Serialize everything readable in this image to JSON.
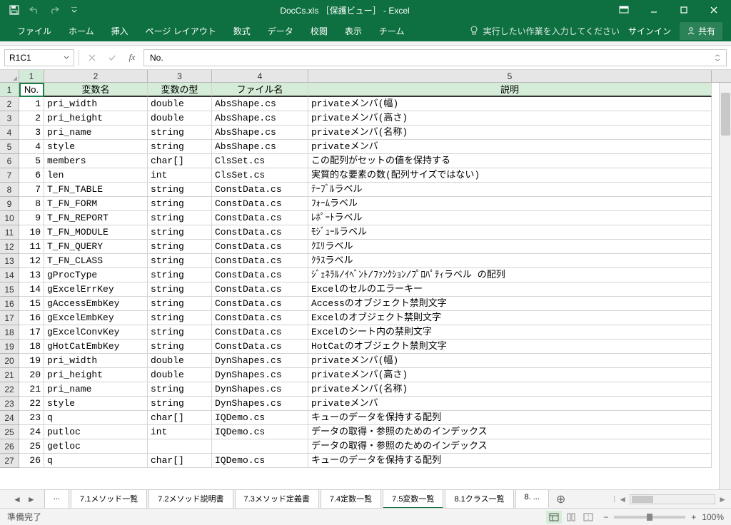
{
  "title": "DocCs.xls ［保護ビュー］ - Excel",
  "ribbon": {
    "tabs": [
      "ファイル",
      "ホーム",
      "挿入",
      "ページ レイアウト",
      "数式",
      "データ",
      "校閲",
      "表示",
      "チーム"
    ],
    "tell": "実行したい作業を入力してください",
    "signin": "サインイン",
    "share": "共有"
  },
  "namebox": "R1C1",
  "formula": "No.",
  "col_nums": [
    "1",
    "2",
    "3",
    "4",
    "5"
  ],
  "headers": [
    "No.",
    "変数名",
    "変数の型",
    "ファイル名",
    "説明"
  ],
  "rows": [
    {
      "n": "1",
      "v": "pri_width",
      "t": "double",
      "f": "AbsShape.cs",
      "d": "privateメンバ(幅)"
    },
    {
      "n": "2",
      "v": "pri_height",
      "t": "double",
      "f": "AbsShape.cs",
      "d": "privateメンバ(高さ)"
    },
    {
      "n": "3",
      "v": "pri_name",
      "t": "string",
      "f": "AbsShape.cs",
      "d": "privateメンバ(名称)"
    },
    {
      "n": "4",
      "v": "style",
      "t": "string",
      "f": "AbsShape.cs",
      "d": "privateメンバ"
    },
    {
      "n": "5",
      "v": "members",
      "t": "char[]",
      "f": "ClsSet.cs",
      "d": "この配列がセットの値を保持する"
    },
    {
      "n": "6",
      "v": "len",
      "t": "int",
      "f": "ClsSet.cs",
      "d": "実質的な要素の数(配列サイズではない)"
    },
    {
      "n": "7",
      "v": "T_FN_TABLE",
      "t": "string",
      "f": "ConstData.cs",
      "d": "ﾃｰﾌﾞﾙラベル"
    },
    {
      "n": "8",
      "v": "T_FN_FORM",
      "t": "string",
      "f": "ConstData.cs",
      "d": "ﾌｫｰﾑラベル"
    },
    {
      "n": "9",
      "v": "T_FN_REPORT",
      "t": "string",
      "f": "ConstData.cs",
      "d": "ﾚﾎﾟｰﾄラベル"
    },
    {
      "n": "10",
      "v": "T_FN_MODULE",
      "t": "string",
      "f": "ConstData.cs",
      "d": "ﾓｼﾞｭｰﾙラベル"
    },
    {
      "n": "11",
      "v": "T_FN_QUERY",
      "t": "string",
      "f": "ConstData.cs",
      "d": "ｸｴﾘラベル"
    },
    {
      "n": "12",
      "v": "T_FN_CLASS",
      "t": "string",
      "f": "ConstData.cs",
      "d": "ｸﾗｽラベル"
    },
    {
      "n": "13",
      "v": "gProcType",
      "t": "string",
      "f": "ConstData.cs",
      "d": "ｼﾞｪﾈﾗﾙ/ｲﾍﾞﾝﾄ/ﾌｧﾝｸｼｮﾝ/ﾌﾟﾛﾊﾟﾃｨラベル の配列"
    },
    {
      "n": "14",
      "v": "gExcelErrKey",
      "t": "string",
      "f": "ConstData.cs",
      "d": "Excelのセルのエラーキー"
    },
    {
      "n": "15",
      "v": "gAccessEmbKey",
      "t": "string",
      "f": "ConstData.cs",
      "d": "Accessのオブジェクト禁則文字"
    },
    {
      "n": "16",
      "v": "gExcelEmbKey",
      "t": "string",
      "f": "ConstData.cs",
      "d": "Excelのオブジェクト禁則文字"
    },
    {
      "n": "17",
      "v": "gExcelConvKey",
      "t": "string",
      "f": "ConstData.cs",
      "d": "Excelのシート内の禁則文字"
    },
    {
      "n": "18",
      "v": "gHotCatEmbKey",
      "t": "string",
      "f": "ConstData.cs",
      "d": "HotCatのオブジェクト禁則文字"
    },
    {
      "n": "19",
      "v": "pri_width",
      "t": "double",
      "f": "DynShapes.cs",
      "d": "privateメンバ(幅)"
    },
    {
      "n": "20",
      "v": "pri_height",
      "t": "double",
      "f": "DynShapes.cs",
      "d": "privateメンバ(高さ)"
    },
    {
      "n": "21",
      "v": "pri_name",
      "t": "string",
      "f": "DynShapes.cs",
      "d": "privateメンバ(名称)"
    },
    {
      "n": "22",
      "v": "style",
      "t": "string",
      "f": "DynShapes.cs",
      "d": "privateメンバ"
    },
    {
      "n": "23",
      "v": "q",
      "t": "char[]",
      "f": "IQDemo.cs",
      "d": "キューのデータを保持する配列"
    },
    {
      "n": "24",
      "v": "putloc",
      "t": "int",
      "f": "IQDemo.cs",
      "d": "データの取得・参照のためのインデックス"
    },
    {
      "n": "25",
      "v": "getloc",
      "t": "",
      "f": "",
      "d": "データの取得・参照のためのインデックス"
    },
    {
      "n": "26",
      "v": "q",
      "t": "char[]",
      "f": "IQDemo.cs",
      "d": "キューのデータを保持する配列"
    }
  ],
  "sheets": [
    "...",
    "7.1メソッド一覧",
    "7.2メソッド説明書",
    "7.3メソッド定義書",
    "7.4定数一覧",
    "7.5変数一覧",
    "8.1クラス一覧",
    "8. ..."
  ],
  "active_sheet": 5,
  "status": "準備完了",
  "zoom": "100%"
}
